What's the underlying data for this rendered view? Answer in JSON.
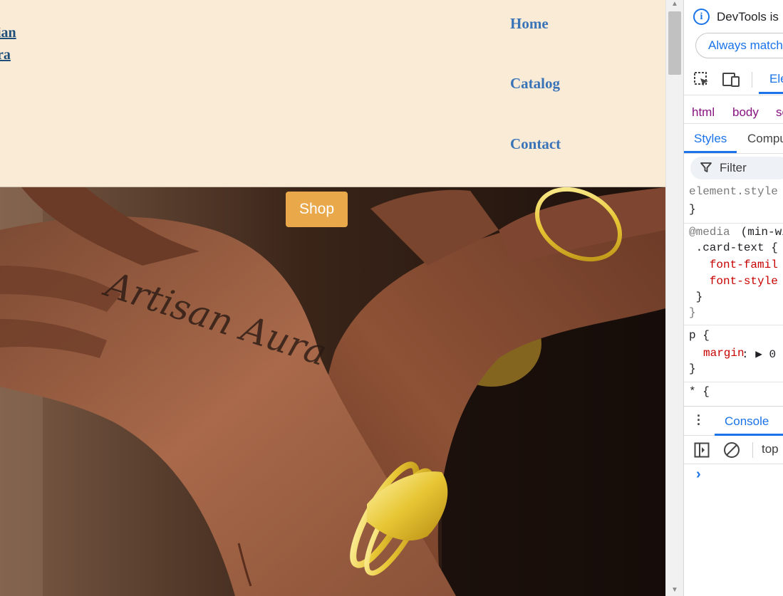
{
  "header": {
    "brand_lines": [
      "ian",
      "ra"
    ],
    "nav": {
      "home": "Home",
      "catalog": "Catalog",
      "contact": "Contact"
    }
  },
  "hero": {
    "tattoo_text": "Artisan Aura",
    "shop_label": "Shop"
  },
  "colors": {
    "header_bg": "#faebd7",
    "nav_link": "#3a74b8",
    "shop_button": "#e9a84a",
    "devtools_accent": "#1a73e8"
  },
  "devtools": {
    "banner_text": "DevTools is",
    "always_match_label": "Always match",
    "main_tab": "Ele",
    "breadcrumbs": [
      "html",
      "body",
      "se"
    ],
    "subtabs": {
      "styles": "Styles",
      "computed": "Compu"
    },
    "filter_placeholder": "Filter",
    "styles_lines": {
      "element_style": "element.style",
      "close1": "}",
      "media_kw": "@media",
      "media_cond": " (min-wi",
      "selector_card": " .card-text {",
      "prop_font_family": "   font-famil",
      "prop_font_style": "   font-style",
      "close_inner": " }",
      "close_media": "}",
      "selector_p": "p {",
      "prop_margin": "margin",
      "margin_rest": ": ▶ 0",
      "close_p": "}",
      "selector_star": "* {"
    },
    "drawer_tab": "Console",
    "console_context": "top",
    "prompt": "›"
  }
}
